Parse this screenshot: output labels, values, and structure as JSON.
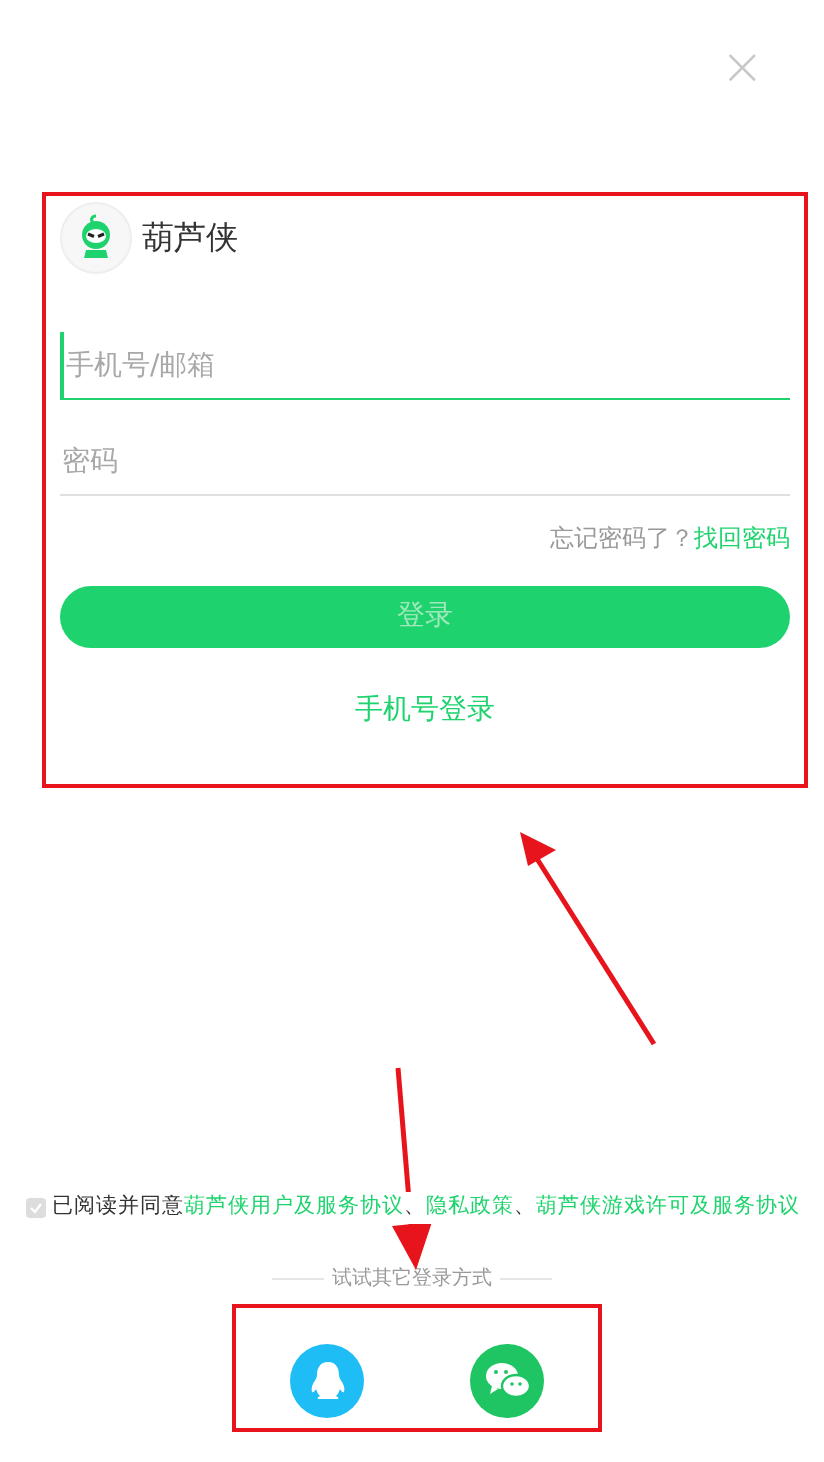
{
  "close": {
    "symbol": "×"
  },
  "brand": {
    "name": "葫芦侠"
  },
  "account_field": {
    "placeholder": "手机号/邮箱",
    "focused": true
  },
  "password_field": {
    "placeholder": "密码",
    "focused": false
  },
  "forgot": {
    "question": "忘记密码了？",
    "link": "找回密码"
  },
  "login_button": {
    "label": "登录",
    "disabled": true
  },
  "phone_login": {
    "label": "手机号登录"
  },
  "agreement": {
    "checked": true,
    "parts": [
      {
        "kind": "text",
        "text": "已阅读并同意"
      },
      {
        "kind": "link",
        "text": "葫芦侠用户及服务协议"
      },
      {
        "kind": "text",
        "text": "、"
      },
      {
        "kind": "link",
        "text": "隐私政策"
      },
      {
        "kind": "text",
        "text": "、"
      },
      {
        "kind": "link",
        "text": "葫芦侠游戏许可及服务协议"
      }
    ]
  },
  "other_login": {
    "label": "试试其它登录方式",
    "options": [
      {
        "kind": "qq"
      },
      {
        "kind": "wechat"
      }
    ]
  }
}
